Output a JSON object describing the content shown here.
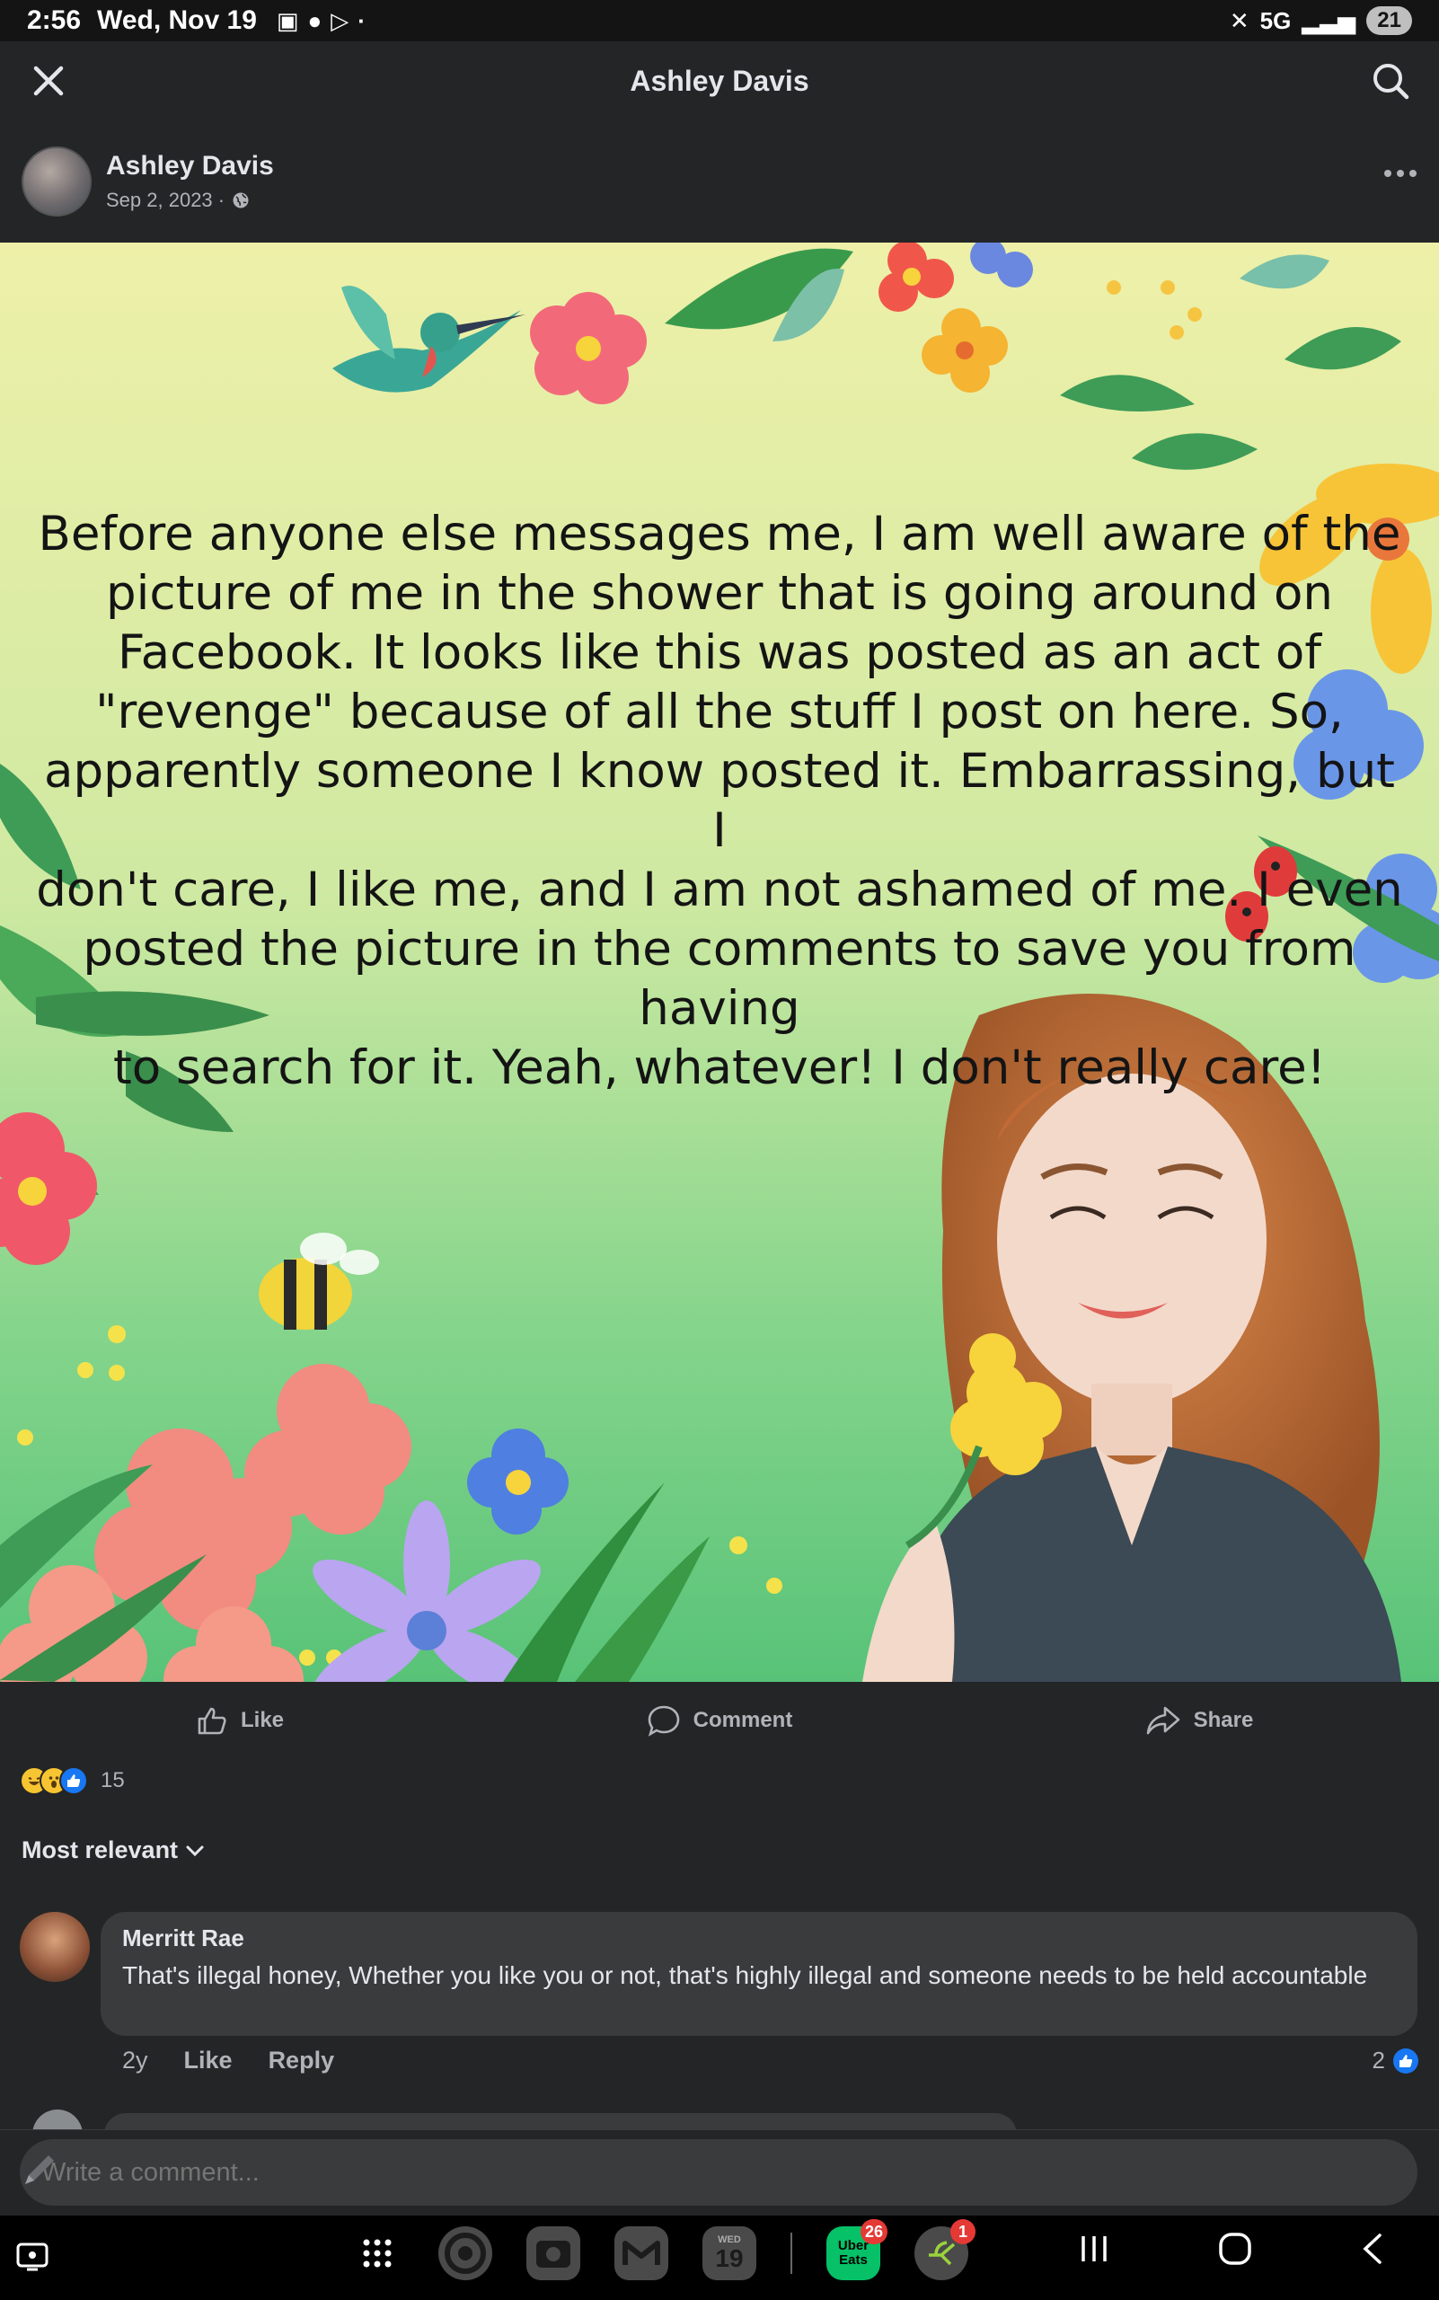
{
  "status_bar": {
    "time": "2:56",
    "date": "Wed, Nov 19",
    "network": "5G",
    "battery": "21"
  },
  "header": {
    "title": "Ashley Davis"
  },
  "post": {
    "author": "Ashley Davis",
    "date": "Sep 2, 2023 ·",
    "privacy_icon": "globe-icon",
    "image_text_lines": [
      "Before anyone else messages me, I am well aware of the",
      "picture of me in the shower that is going around on",
      "Facebook. It looks like this was posted as an act of",
      "\"revenge\" because of all the stuff I post on here.  So,",
      "apparently someone I know posted it.  Embarrassing, but I",
      "don't care,  I like me, and I am not ashamed of me. I even",
      "posted the picture in the comments to save you from having",
      "to search for it.  Yeah, whatever!  I don't really care!"
    ]
  },
  "actions": {
    "like": "Like",
    "comment": "Comment",
    "share": "Share"
  },
  "reactions": {
    "count": "15",
    "types": [
      "haha",
      "wow",
      "like"
    ]
  },
  "sort": {
    "label": "Most relevant"
  },
  "comments": [
    {
      "name": "Merritt Rae",
      "text": "That's illegal honey, Whether you like you or not, that's highly illegal and someone needs to be held accountable",
      "age": "2y",
      "like_label": "Like",
      "reply_label": "Reply",
      "likes": "2"
    }
  ],
  "composer": {
    "placeholder": "Write a comment..."
  },
  "dock": {
    "calendar_day": "19",
    "calendar_weekday": "WED",
    "ubereats_label": "Uber Eats",
    "ubereats_badge": "26",
    "app_badge": "1"
  },
  "colors": {
    "background": "#242526",
    "bubble": "#3a3b3c",
    "text_primary": "#e4e6eb",
    "text_secondary": "#b0b3b8",
    "like_blue": "#1877f2"
  }
}
